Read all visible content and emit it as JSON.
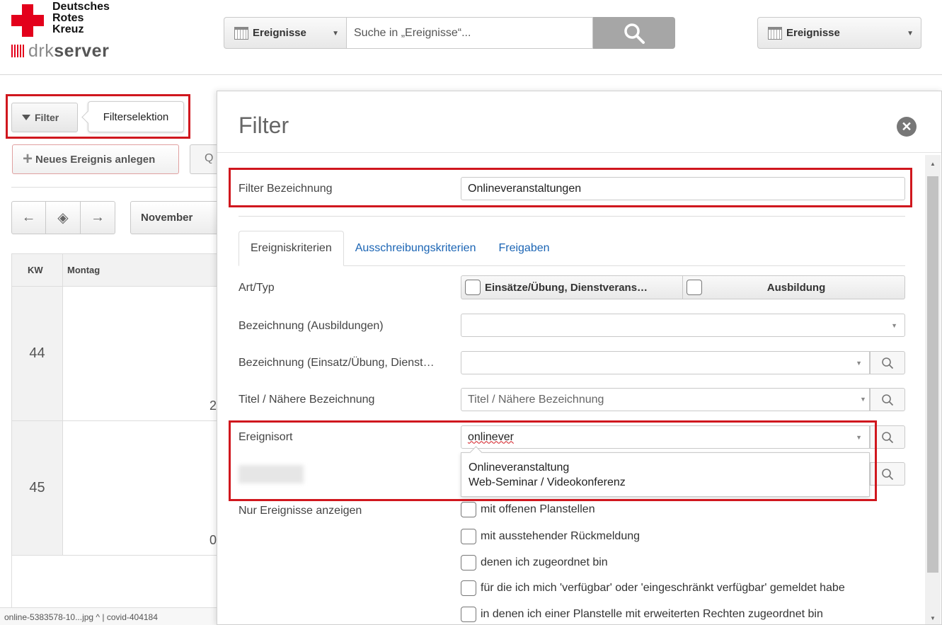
{
  "header": {
    "logo_lines": [
      "Deutsches",
      "Rotes",
      "Kreuz"
    ],
    "logo_server_light": "drk",
    "logo_server_bold": "server",
    "scope_select": "Ereignisse",
    "search_placeholder": "Suche in „Ereignisse“...",
    "right_select": "Ereignisse"
  },
  "left": {
    "filter_button": "Filter",
    "tooltip": "Filterselektion",
    "new_event_button": "Neues Ereignis anlegen",
    "month_select": "November",
    "table_head": {
      "kw": "KW",
      "day": "Montag"
    },
    "rows": [
      {
        "kw": "44",
        "day_num": "2"
      },
      {
        "kw": "45",
        "day_num": "0"
      }
    ],
    "bottom_bar": "online-5383578-10...jpg  ^   |   covid-404184"
  },
  "modal": {
    "title": "Filter",
    "filter_label": "Filter Bezeichnung",
    "filter_value": "Onlineveranstaltungen",
    "tabs": [
      "Ereigniskriterien",
      "Ausschreibungskriterien",
      "Freigaben"
    ],
    "art_label": "Art/Typ",
    "art_options": [
      "Einsätze/Übung, Dienstverans…",
      "Ausbildung"
    ],
    "bez_ausb_label": "Bezeichnung (Ausbildungen)",
    "bez_einsatz_label": "Bezeichnung (Einsatz/Übung, Dienst…",
    "titel_label": "Titel / Nähere Bezeichnung",
    "titel_placeholder": "Titel / Nähere Bezeichnung",
    "ort_label": "Ereignisort",
    "ort_value": "onlinever",
    "ort_suggestions": [
      "Onlineveranstaltung",
      "Web-Seminar / Videokonferenz"
    ],
    "nur_label": "Nur Ereignisse anzeigen",
    "checkboxes": [
      "mit offenen Planstellen",
      "mit ausstehender Rückmeldung",
      "denen ich zugeordnet bin",
      "für die ich mich 'verfügbar' oder 'eingeschränkt verfügbar' gemeldet habe",
      "in denen ich einer Planstelle mit erweiterten Rechten zugeordnet bin"
    ]
  },
  "colors": {
    "brand_red": "#e3001b",
    "highlight_red": "#d0171e",
    "link_blue": "#1a64b4",
    "search_button": "#a6a6a6"
  }
}
